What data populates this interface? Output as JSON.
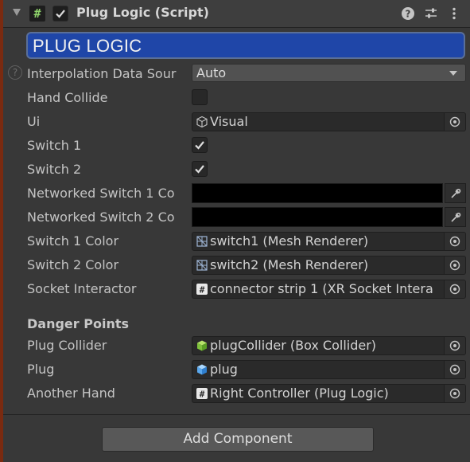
{
  "header": {
    "title": "Plug Logic (Script)",
    "enabled": true,
    "icons": [
      "foldout-arrow-icon",
      "csharp-script-icon",
      "help-icon",
      "presets-icon",
      "kebab-menu-icon"
    ]
  },
  "banner": {
    "text": "PLUG LOGIC",
    "color": "#1f46a8"
  },
  "fields": {
    "interpolation": {
      "label": "Interpolation Data Sour",
      "value": "Auto"
    },
    "hand_collide": {
      "label": "Hand Collide",
      "checked": false
    },
    "ui": {
      "label": "Ui",
      "value": "Visual",
      "icon": "cube-outline-icon"
    },
    "switch1": {
      "label": "Switch 1",
      "checked": true
    },
    "switch2": {
      "label": "Switch 2",
      "checked": true
    },
    "networked_switch1": {
      "label": "Networked Switch 1 Co",
      "color": "#000000"
    },
    "networked_switch2": {
      "label": "Networked Switch 2 Co",
      "color": "#000000"
    },
    "switch1_color": {
      "label": "Switch 1 Color",
      "value": "switch1 (Mesh Renderer)",
      "icon": "mesh-renderer-icon"
    },
    "switch2_color": {
      "label": "Switch 2 Color",
      "value": "switch2 (Mesh Renderer)",
      "icon": "mesh-renderer-icon"
    },
    "socket_interactor": {
      "label": "Socket Interactor",
      "value": "connector strip 1 (XR Socket Intera",
      "icon": "script-icon"
    }
  },
  "danger": {
    "heading": "Danger Points",
    "plug_collider": {
      "label": "Plug Collider",
      "value": "plugCollider (Box Collider)",
      "icon": "box-collider-icon"
    },
    "plug": {
      "label": "Plug",
      "value": "plug",
      "icon": "prefab-cube-icon"
    },
    "another_hand": {
      "label": "Another Hand",
      "value": "Right Controller (Plug Logic)",
      "icon": "script-icon"
    }
  },
  "add_component": {
    "label": "Add Component"
  }
}
